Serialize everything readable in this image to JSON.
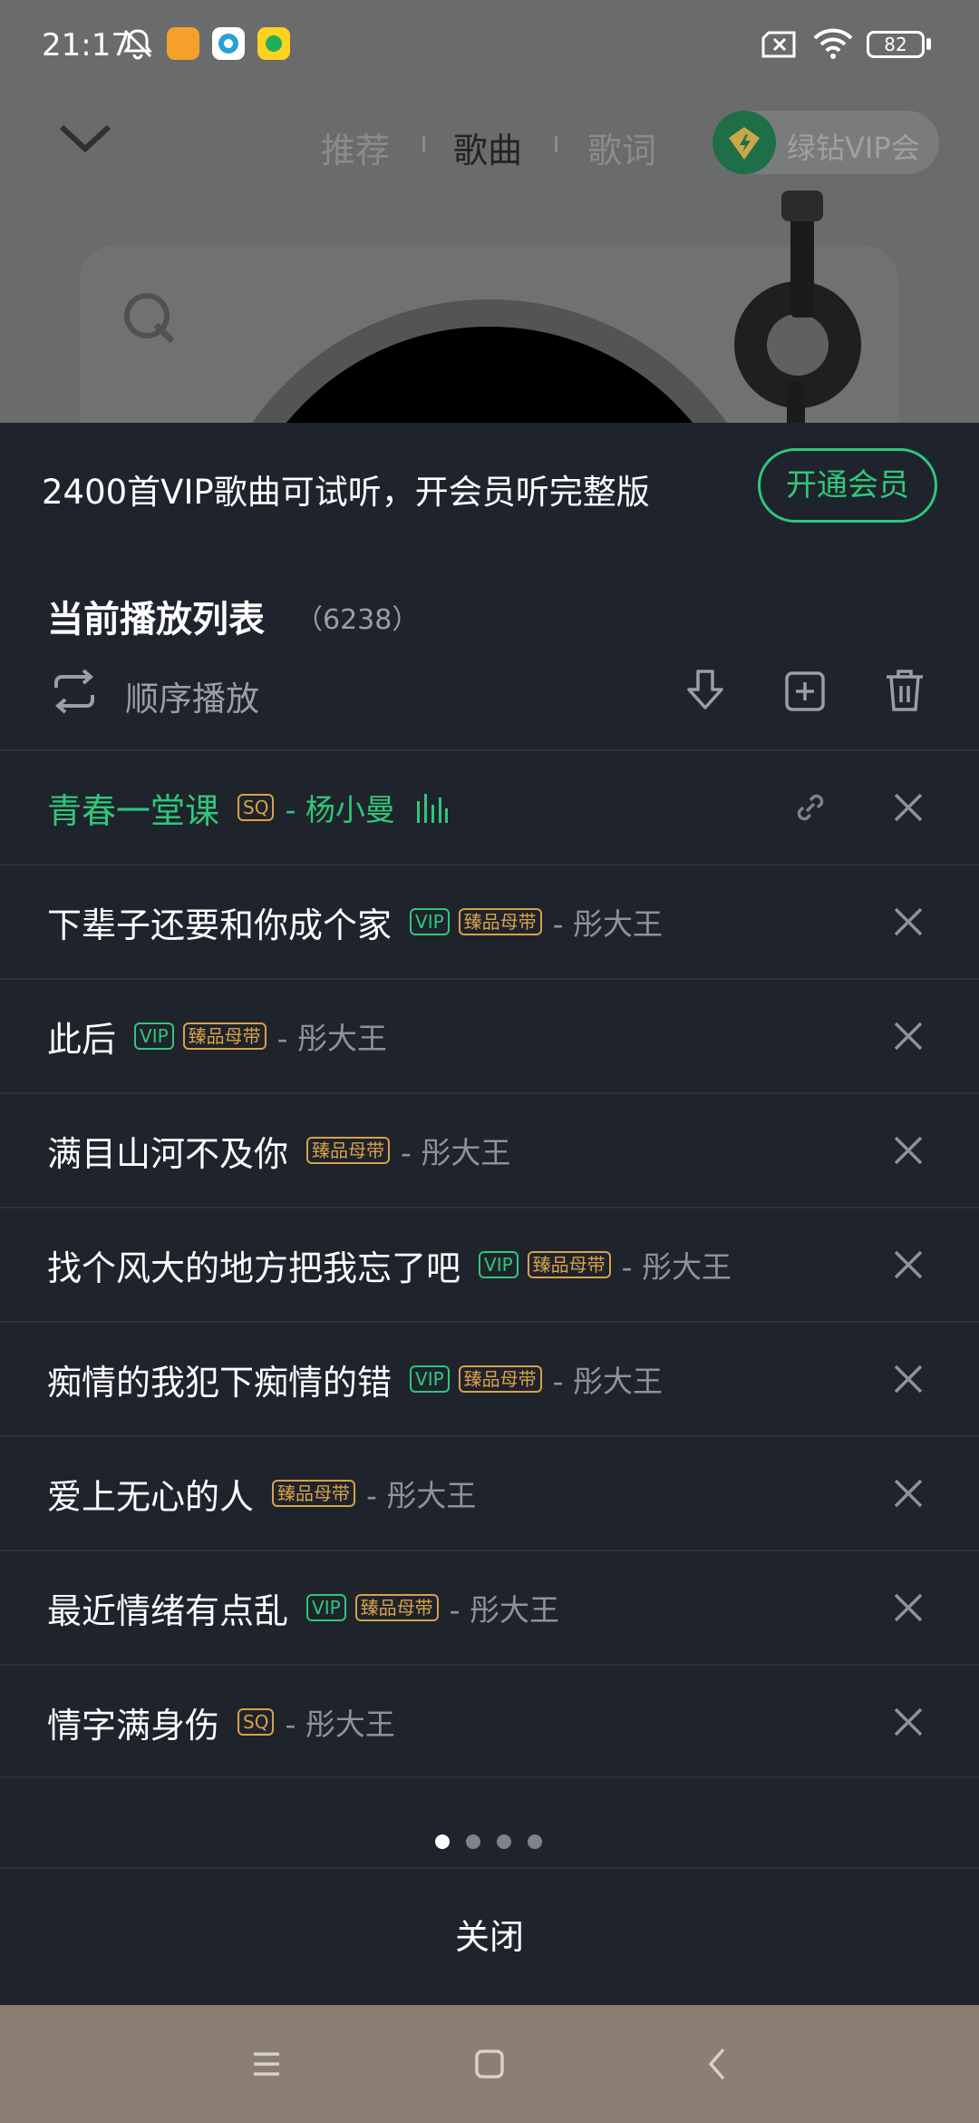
{
  "status_bar": {
    "time": "21:17",
    "battery": "82",
    "icons": [
      "mute-bell-icon",
      "app-badge-orange",
      "app-badge-blue",
      "app-badge-yellow",
      "sim-x-icon",
      "wifi-icon"
    ]
  },
  "player": {
    "tabs": [
      "推荐",
      "歌曲",
      "歌词"
    ],
    "active_tab": "歌曲",
    "vip_pill_label": "绿钻VIP会"
  },
  "sheet": {
    "promo_text": "2400首VIP歌曲可试听，开会员听完整版",
    "promo_button": "开通会员",
    "list_title": "当前播放列表",
    "list_count": "（6238）",
    "mode_label": "顺序播放",
    "toolbar_icons": [
      "download-icon",
      "add-to-playlist-icon",
      "trash-icon"
    ],
    "songs": [
      {
        "title": "青春一堂课",
        "tags": [
          "SQ"
        ],
        "artist": "- 杨小曼",
        "current": true
      },
      {
        "title": "下辈子还要和你成个家",
        "tags": [
          "VIP",
          "臻品母带"
        ],
        "artist": "- 彤大王"
      },
      {
        "title": "此后",
        "tags": [
          "VIP",
          "臻品母带"
        ],
        "artist": "- 彤大王"
      },
      {
        "title": "满目山河不及你",
        "tags": [
          "臻品母带"
        ],
        "artist": "- 彤大王"
      },
      {
        "title": "找个风大的地方把我忘了吧",
        "tags": [
          "VIP",
          "臻品母带"
        ],
        "artist": "- 彤大王"
      },
      {
        "title": "痴情的我犯下痴情的错",
        "tags": [
          "VIP",
          "臻品母带"
        ],
        "artist": "- 彤大王"
      },
      {
        "title": "爱上无心的人",
        "tags": [
          "臻品母带"
        ],
        "artist": "- 彤大王"
      },
      {
        "title": "最近情绪有点乱",
        "tags": [
          "VIP",
          "臻品母带"
        ],
        "artist": "- 彤大王"
      },
      {
        "title": "情字满身伤",
        "tags": [
          "SQ"
        ],
        "artist": "- 彤大王"
      }
    ],
    "page_dots": {
      "count": 4,
      "active": 1
    },
    "close_label": "关闭"
  },
  "colors": {
    "accent_green": "#2fc77a",
    "tag_gold": "#d6a24a",
    "sheet_bg": "#1f232c"
  }
}
